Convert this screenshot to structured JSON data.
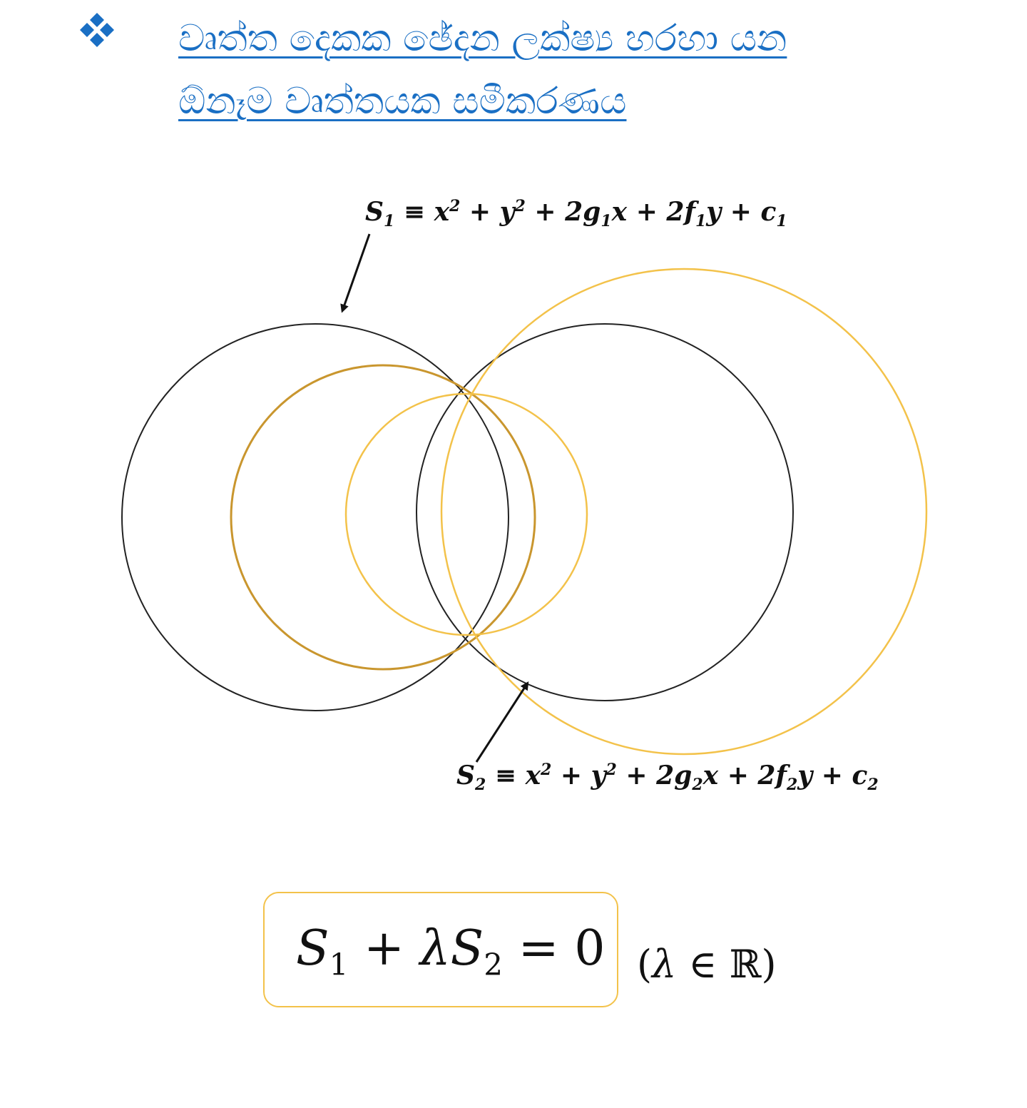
{
  "title": {
    "line1": "වෘත්ත දෙකක ඡේදන ලක්ෂ්‍ය හරහා යන",
    "line2": "ඕනෑම වෘත්තයක සමීකරණය",
    "color": "#1a6fc4"
  },
  "labels": {
    "s1": {
      "lhs": "S",
      "lhs_sub": "1",
      "equiv": "≡",
      "x": "x",
      "x_sup": "2",
      "plus1": "+",
      "y": "y",
      "y_sup": "2",
      "plus2": "+",
      "g_term": "2g",
      "g_sub": "1",
      "g_var": "x",
      "plus3": "+",
      "f_term": "2f",
      "f_sub": "1",
      "f_var": "y",
      "plus4": "+",
      "c": "c",
      "c_sub": "1"
    },
    "s2": {
      "lhs": "S",
      "lhs_sub": "2",
      "equiv": "≡",
      "x": "x",
      "x_sup": "2",
      "plus1": "+",
      "y": "y",
      "y_sup": "2",
      "plus2": "+",
      "g_term": "2g",
      "g_sub": "2",
      "g_var": "x",
      "plus3": "+",
      "f_term": "2f",
      "f_sub": "2",
      "f_var": "y",
      "plus4": "+",
      "c": "c",
      "c_sub": "2"
    }
  },
  "result": {
    "s1": "S",
    "s1_sub": "1",
    "plus": "+",
    "lambda": "λ",
    "s2": "S",
    "s2_sub": "2",
    "equals": "=",
    "zero": "0",
    "cond_open": "(",
    "cond_lambda": "λ",
    "cond_in": "∈",
    "cond_set": "ℝ",
    "cond_close": ")",
    "box_color": "#f3c24a"
  },
  "colors": {
    "circle_black": "#222222",
    "circle_gold": "#f3c24a",
    "circle_dark_gold": "#c9962e",
    "bullet": "#1a6fc4"
  },
  "icons": {
    "bullet": "four-diamond-bullet-icon",
    "arrow": "arrow-icon"
  }
}
